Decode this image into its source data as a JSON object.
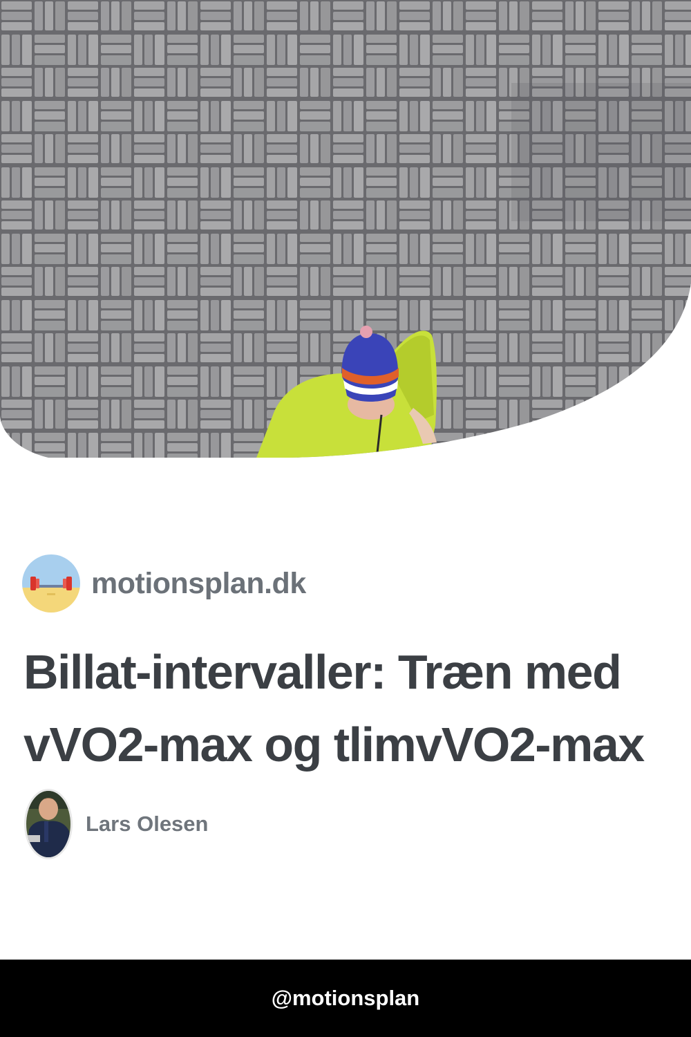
{
  "hero": {
    "image": "runner-on-paved-bricks",
    "colors": {
      "paving": "#9a9a9c",
      "jacket": "#c8e03a",
      "hat": "#3a44b8",
      "hat_stripe": "#e0602a"
    }
  },
  "site": {
    "name": "motionsplan.dk",
    "logo_icon": "dumbbell-on-beach-icon"
  },
  "article": {
    "title": "Billat-intervaller: Træn med vVO2-max og tlimvVO2-max"
  },
  "author": {
    "name": "Lars Olesen",
    "avatar_icon": "author-photo"
  },
  "footer": {
    "handle": "@motionsplan"
  },
  "colors": {
    "title": "#3b3f44",
    "muted": "#6b7178",
    "footer_bg": "#000000",
    "footer_text": "#ffffff"
  }
}
